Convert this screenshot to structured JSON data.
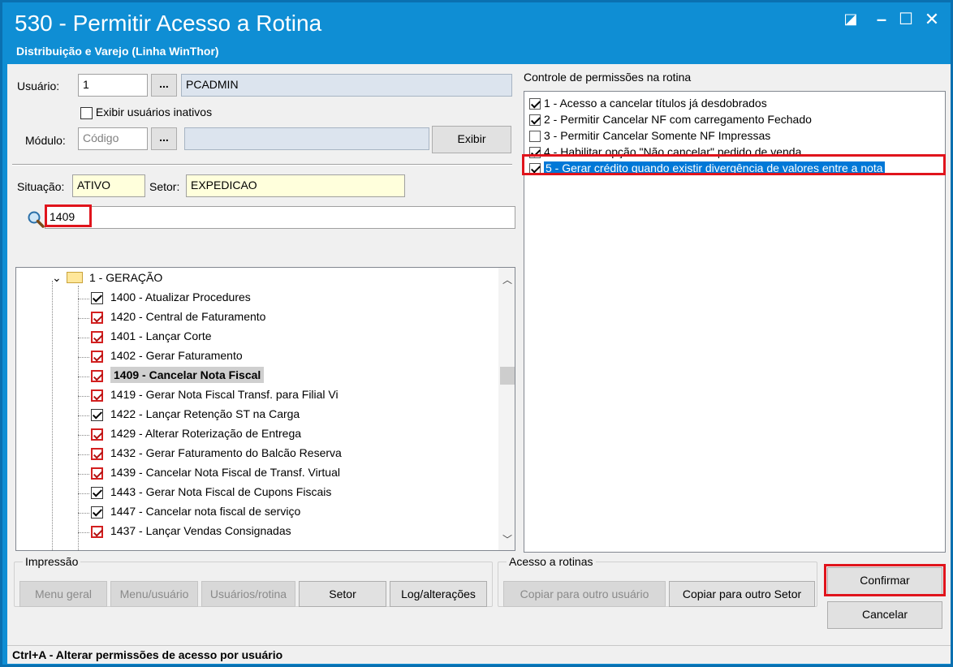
{
  "window": {
    "title": "530 - Permitir Acesso a Rotina",
    "subtitle": "Distribuição e Varejo (Linha WinThor)",
    "controls": {
      "restore": "◪",
      "minimize": "–",
      "maximize": "☐",
      "close": "✕"
    }
  },
  "user": {
    "label": "Usuário:",
    "code": "1",
    "browse": "...",
    "name": "PCADMIN",
    "show_inactive_label": "Exibir usuários inativos"
  },
  "module": {
    "label": "Módulo:",
    "placeholder": "Código",
    "browse": "...",
    "name": "",
    "show_button": "Exibir"
  },
  "situacao": {
    "label": "Situação:",
    "value": "ATIVO"
  },
  "setor": {
    "label": "Setor:",
    "value": "EXPEDICAO"
  },
  "search": {
    "icon": "magnifier-icon",
    "value": "1409"
  },
  "tree": {
    "root_label": "1 - GERAÇÃO",
    "items": [
      {
        "label": "1400 - Atualizar Procedures",
        "checked": true,
        "red": false
      },
      {
        "label": "1420 - Central de Faturamento",
        "checked": true,
        "red": true
      },
      {
        "label": "1401 - Lançar Corte",
        "checked": true,
        "red": true
      },
      {
        "label": "1402 - Gerar Faturamento",
        "checked": true,
        "red": true
      },
      {
        "label": "1409 - Cancelar Nota Fiscal",
        "checked": true,
        "red": true,
        "selected": true
      },
      {
        "label": "1419 - Gerar Nota Fiscal Transf. para Filial Vi",
        "checked": true,
        "red": true
      },
      {
        "label": "1422 - Lançar Retenção ST na Carga",
        "checked": true,
        "red": false
      },
      {
        "label": "1429 - Alterar Roterização de Entrega",
        "checked": true,
        "red": true
      },
      {
        "label": "1432 - Gerar Faturamento do Balcão Reserva",
        "checked": true,
        "red": true
      },
      {
        "label": "1439 - Cancelar Nota Fiscal de Transf. Virtual",
        "checked": true,
        "red": true
      },
      {
        "label": "1443 - Gerar Nota Fiscal de Cupons Fiscais",
        "checked": true,
        "red": false
      },
      {
        "label": "1447 - Cancelar nota fiscal de serviço",
        "checked": true,
        "red": false
      },
      {
        "label": "1437 - Lançar Vendas Consignadas",
        "checked": true,
        "red": true
      }
    ]
  },
  "permissions": {
    "title": "Controle de permissões na rotina",
    "items": [
      {
        "label": "1 - Acesso a cancelar títulos já desdobrados",
        "checked": true
      },
      {
        "label": "2 - Permitir Cancelar NF com carregamento Fechado",
        "checked": true
      },
      {
        "label": "3 - Permitir Cancelar Somente NF Impressas",
        "checked": false
      },
      {
        "label": "4 - Habilitar opção \"Não cancelar\" pedido de venda",
        "checked": true
      },
      {
        "label": "5 - Gerar crédito quando existir divergência de valores entre a nota",
        "checked": true,
        "selected": true
      }
    ]
  },
  "impressao": {
    "title": "Impressão",
    "buttons": {
      "menu_geral": "Menu geral",
      "menu_usuario": "Menu/usuário",
      "usuarios_rotina": "Usuários/rotina",
      "setor": "Setor",
      "log": "Log/alterações"
    }
  },
  "acesso": {
    "title": "Acesso a rotinas",
    "copy_user": "Copiar para outro usuário",
    "copy_sector": "Copiar para outro Setor"
  },
  "actions": {
    "confirm": "Confirmar",
    "cancel": "Cancelar"
  },
  "status": "Ctrl+A - Alterar permissões de acesso por usuário",
  "colors": {
    "title_bar": "#0f8ed4",
    "highlight": "#e0141c",
    "selection": "#0078d7"
  }
}
